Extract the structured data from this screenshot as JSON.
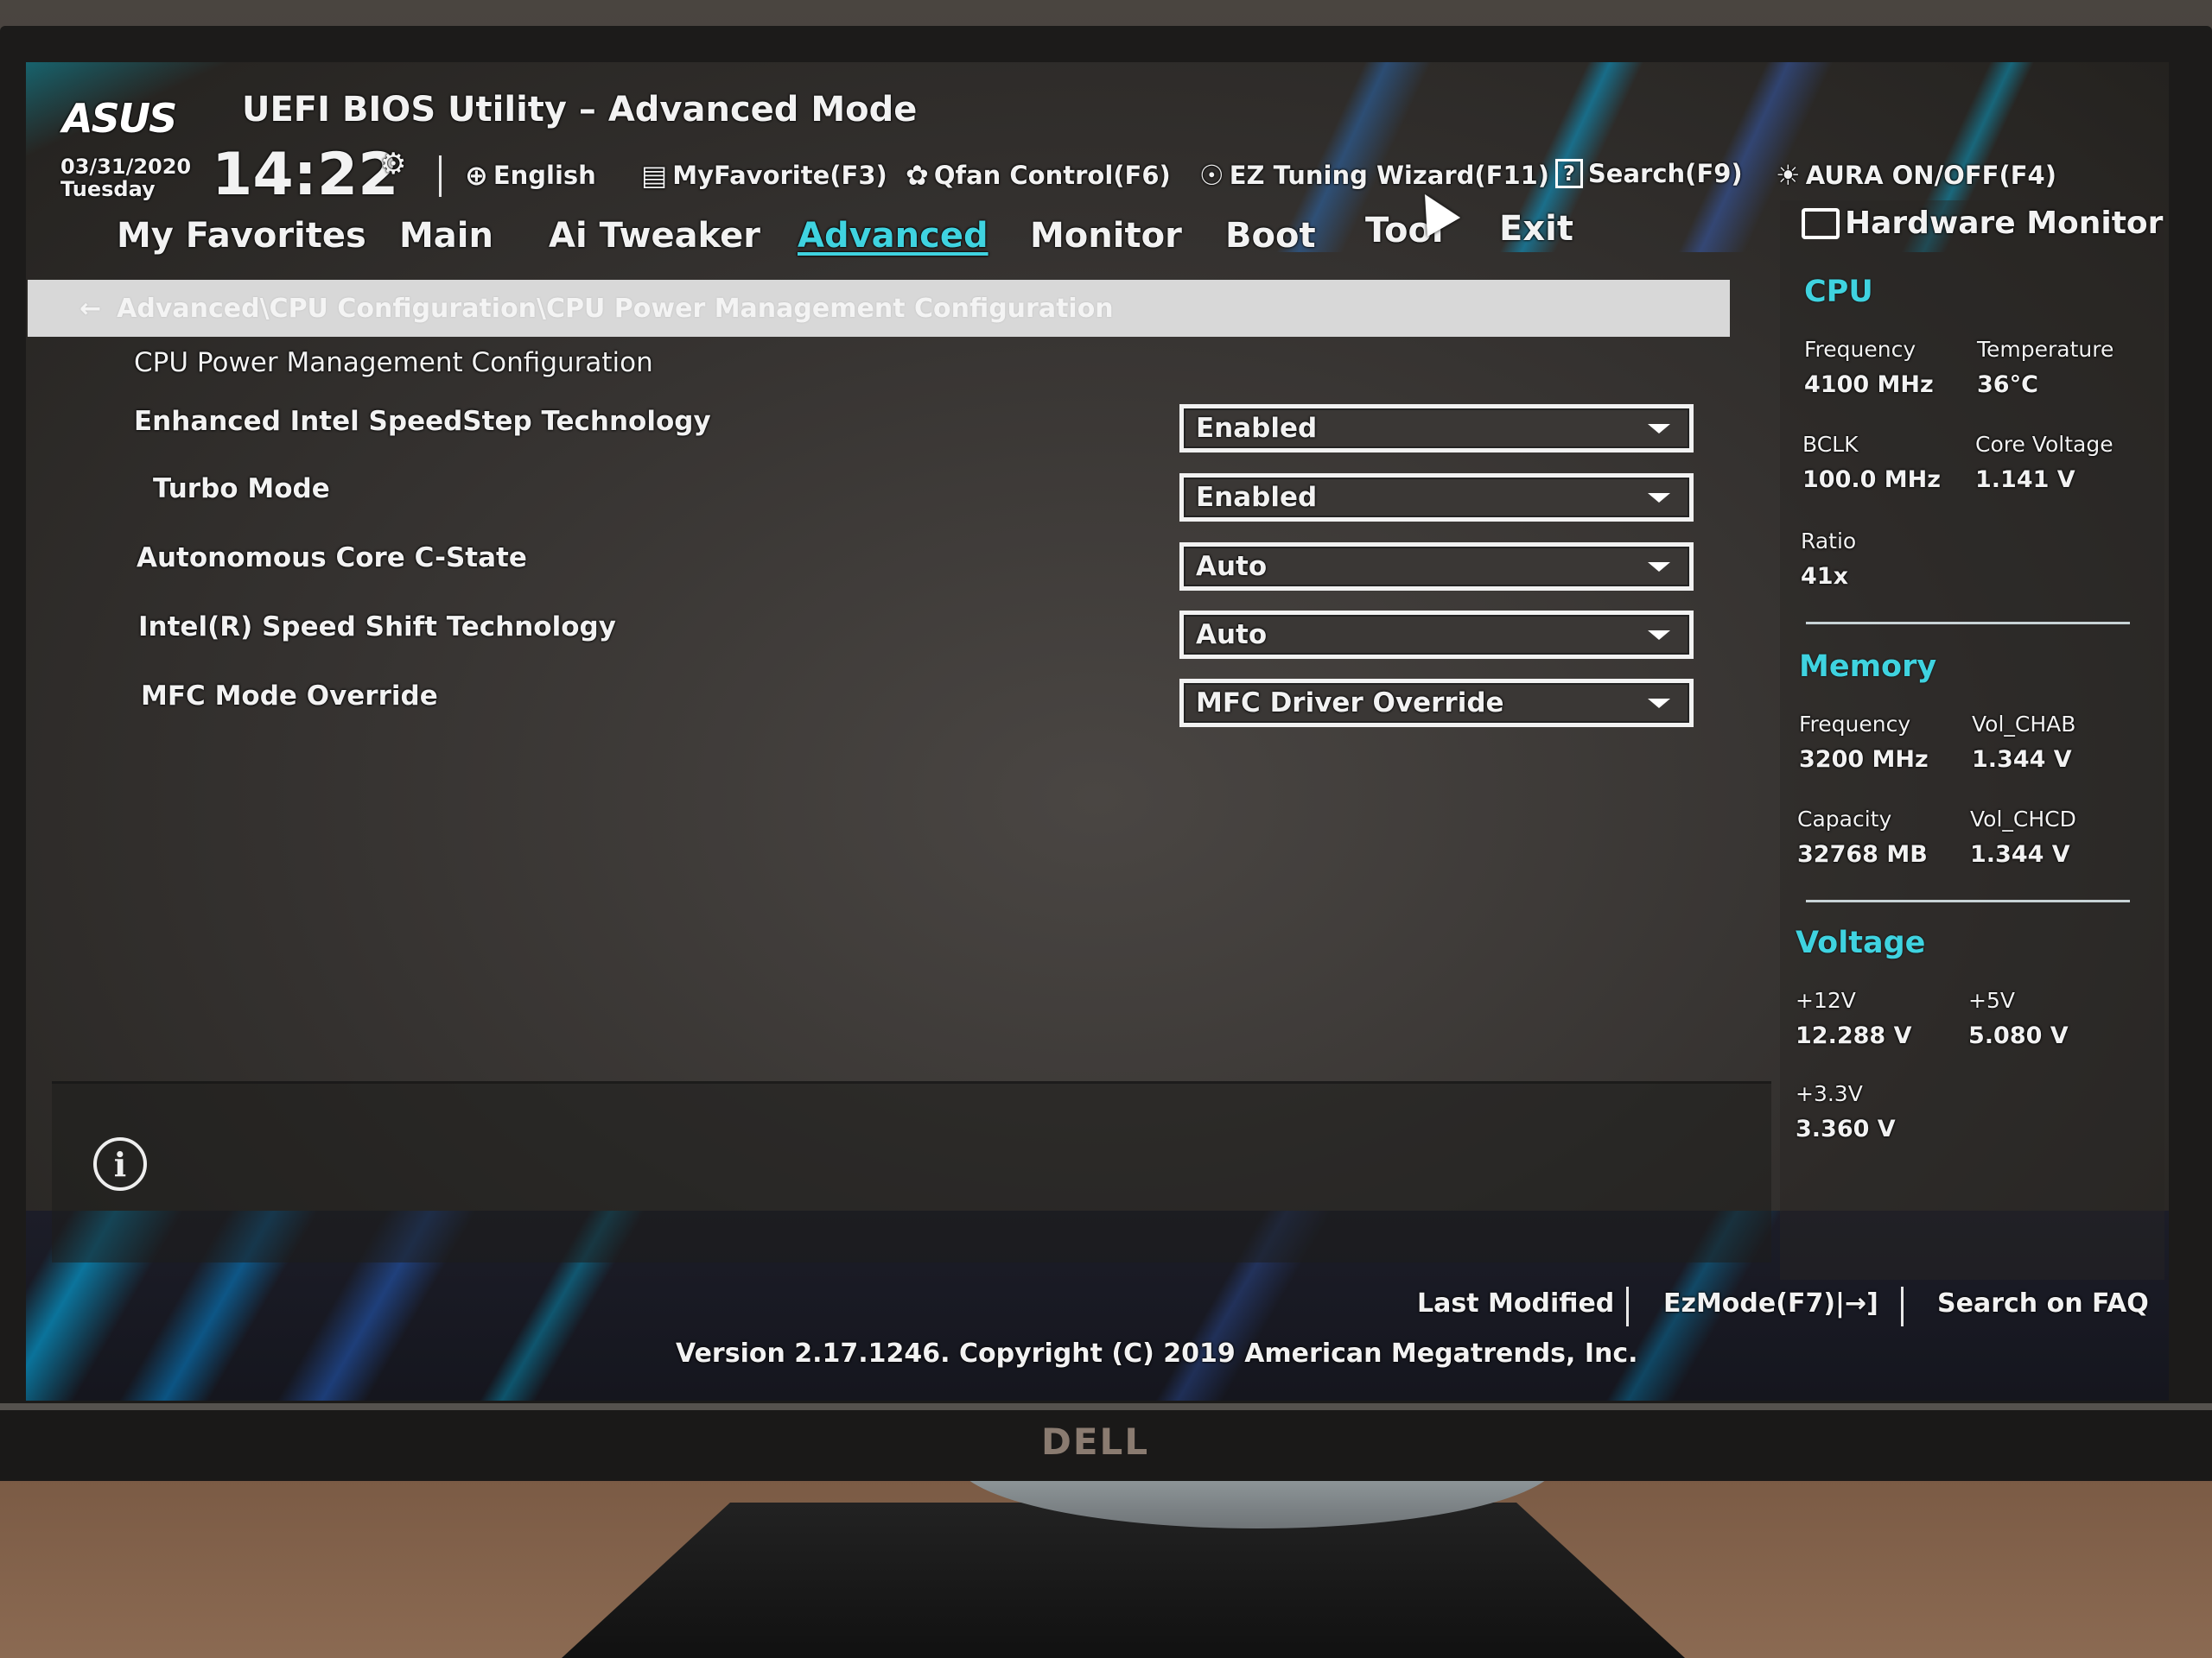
{
  "window": {
    "brand": "ASUS",
    "title": "UEFI BIOS Utility – Advanced Mode"
  },
  "status": {
    "date": "03/31/2020",
    "day": "Tuesday",
    "time": "14:22"
  },
  "toolbar": [
    {
      "icon": "globe-icon",
      "glyph": "⊕",
      "label": "English"
    },
    {
      "icon": "favorite-icon",
      "glyph": "▤",
      "label": "MyFavorite(F3)"
    },
    {
      "icon": "fan-icon",
      "glyph": "✿",
      "label": "Qfan Control(F6)"
    },
    {
      "icon": "lightbulb-icon",
      "glyph": "☉",
      "label": "EZ Tuning Wizard(F11)"
    },
    {
      "icon": "help-search-icon",
      "glyph": "?",
      "label": "Search(F9)"
    },
    {
      "icon": "aura-icon",
      "glyph": "☀",
      "label": "AURA ON/OFF(F4)"
    }
  ],
  "tabs": [
    {
      "label": "My Favorites",
      "active": false
    },
    {
      "label": "Main",
      "active": false
    },
    {
      "label": "Ai Tweaker",
      "active": false
    },
    {
      "label": "Advanced",
      "active": true
    },
    {
      "label": "Monitor",
      "active": false
    },
    {
      "label": "Boot",
      "active": false
    },
    {
      "label": "Tool",
      "active": false
    },
    {
      "label": "Exit",
      "active": false
    }
  ],
  "breadcrumb": {
    "back_glyph": "←",
    "path": "Advanced\\CPU Configuration\\CPU Power Management Configuration"
  },
  "main": {
    "section_title": "CPU Power Management Configuration",
    "items": [
      {
        "label": "Enhanced Intel SpeedStep Technology",
        "value": "Enabled"
      },
      {
        "label": "Turbo Mode",
        "value": "Enabled"
      },
      {
        "label": "Autonomous Core C-State",
        "value": "Auto"
      },
      {
        "label": "Intel(R) Speed Shift Technology",
        "value": "Auto"
      },
      {
        "label": "MFC Mode Override",
        "value": "MFC Driver Override"
      }
    ]
  },
  "help": {
    "info_glyph": "i"
  },
  "hardware_monitor": {
    "title": "Hardware Monitor",
    "accent_color": "#3fd3e0",
    "cpu": {
      "title": "CPU",
      "frequency_label": "Frequency",
      "frequency": "4100 MHz",
      "temperature_label": "Temperature",
      "temperature": "36°C",
      "bclk_label": "BCLK",
      "bclk": "100.0 MHz",
      "core_voltage_label": "Core Voltage",
      "core_voltage": "1.141 V",
      "ratio_label": "Ratio",
      "ratio": "41x"
    },
    "memory": {
      "title": "Memory",
      "frequency_label": "Frequency",
      "frequency": "3200 MHz",
      "vol_chab_label": "Vol_CHAB",
      "vol_chab": "1.344 V",
      "capacity_label": "Capacity",
      "capacity": "32768 MB",
      "vol_chcd_label": "Vol_CHCD",
      "vol_chcd": "1.344 V"
    },
    "voltage": {
      "title": "Voltage",
      "v12_label": "+12V",
      "v12": "12.288 V",
      "v5_label": "+5V",
      "v5": "5.080 V",
      "v33_label": "+3.3V",
      "v33": "3.360 V"
    }
  },
  "footer": {
    "last_modified": "Last Modified",
    "ez_mode": "EzMode(F7)|→]",
    "search_faq": "Search on FAQ",
    "version": "Version 2.17.1246. Copyright (C) 2019 American Megatrends, Inc."
  },
  "monitor_brand": "DELL"
}
